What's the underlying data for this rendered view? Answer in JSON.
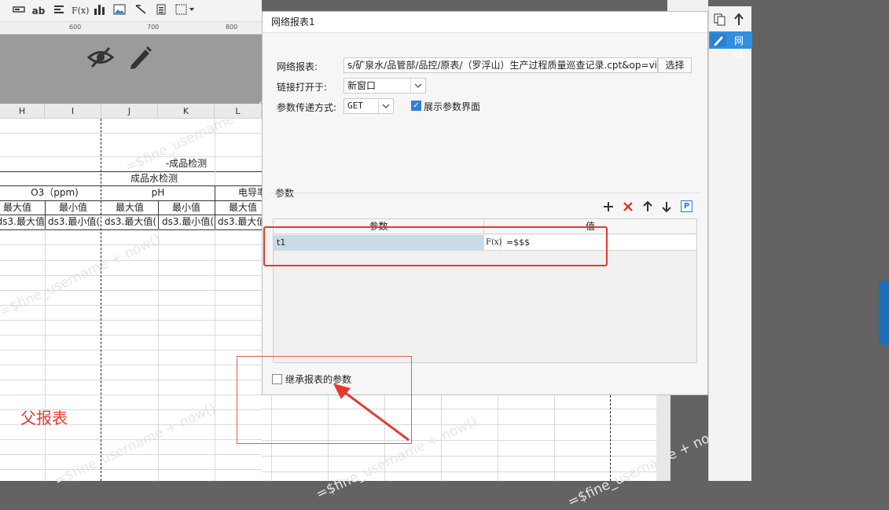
{
  "toolbar": {
    "icons": [
      "textfield-icon",
      "ab-text-icon",
      "align-icon",
      "formula-icon",
      "bar-chart-icon",
      "image-icon",
      "slash-icon",
      "sheet-icon",
      "border-icon"
    ],
    "formula_label": "F(x)",
    "ab_label": "ab"
  },
  "ruler": {
    "ticks": [
      "600",
      "700",
      "800"
    ]
  },
  "sheet": {
    "columns": [
      "H",
      "I",
      "J",
      "K",
      "L"
    ],
    "rows": {
      "title1": "-成品检测",
      "title2": "成品水检测",
      "group_o3": "O3（ppm)",
      "group_ph": "pH",
      "group_ec": "电导率",
      "sub_max": "最大值",
      "sub_min": "最小值",
      "data": [
        "ds3.最大值(",
        "ds3.最小值(",
        "ds3.最大值(",
        "ds3.最小值(",
        "ds3.最大值("
      ]
    },
    "annotation": "父报表",
    "watermark": "=$fine_username + now()"
  },
  "dialog": {
    "title": "网络报表1",
    "report_label": "网络报表:",
    "report_path": "s/矿泉水/品管部/品控/原表/（罗浮山）生产过程质量巡查记录.cpt&op=view",
    "choose_button": "选择",
    "open_label": "链接打开于:",
    "open_value": "新窗口",
    "method_label": "参数传递方式:",
    "method_value": "GET",
    "show_params_label": "展示参数界面",
    "show_params_checked": true,
    "params_title": "参数",
    "param_col": "参数",
    "value_col": "值",
    "params": [
      {
        "name": "t1",
        "value": "=$$$"
      }
    ],
    "formula_glyph": "F(x)",
    "inherit_label": "继承报表的参数",
    "inherit_checked": false
  },
  "right_panel": {
    "item_label": "网络"
  },
  "colors": {
    "accent": "#2f7fd8",
    "highlight": "#e23b2e",
    "param_row": "#c9dbe9"
  }
}
